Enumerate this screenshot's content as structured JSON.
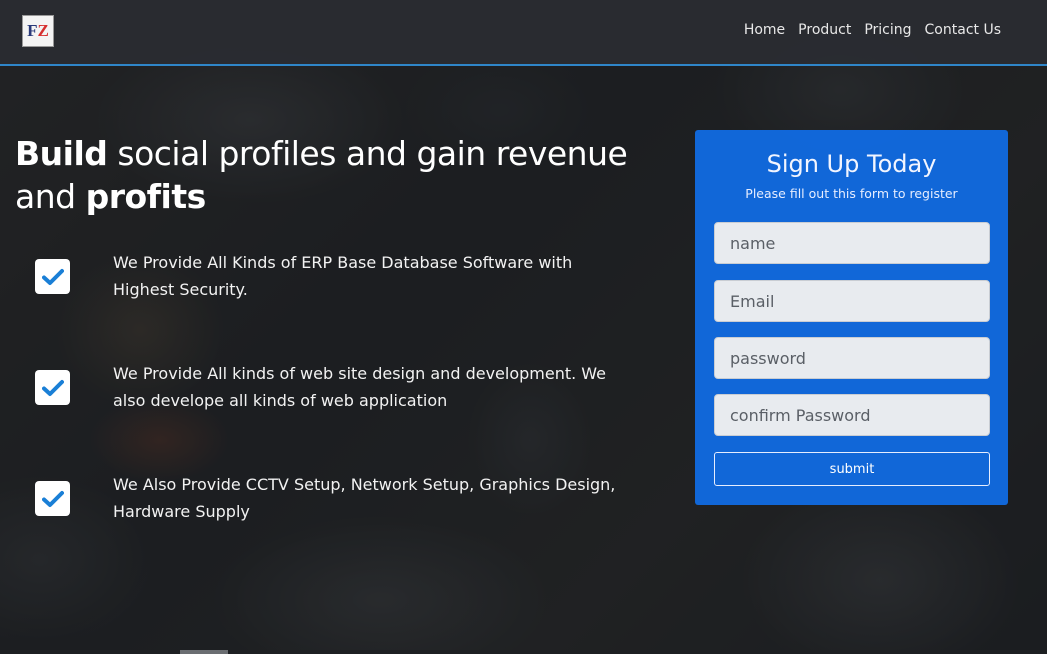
{
  "brand": {
    "logo_text_a": "F",
    "logo_text_b": "Z"
  },
  "nav": {
    "items": [
      "Home",
      "Product",
      "Pricing",
      "Contact Us"
    ]
  },
  "hero": {
    "title_bold_1": "Build",
    "title_mid": " social profiles and gain revenue and ",
    "title_bold_2": "profits"
  },
  "features": [
    {
      "text": "We Provide All Kinds of ERP Base Database Software with Highest Security."
    },
    {
      "text": "We Provide All kinds of web site design and development. We also develope all kinds of web application"
    },
    {
      "text": "We Also Provide CCTV Setup, Network Setup, Graphics Design, Hardware Supply"
    }
  ],
  "signup": {
    "title": "Sign Up Today",
    "subtitle": "Please fill out this form to register",
    "name_placeholder": "name",
    "email_placeholder": "Email",
    "password_placeholder": "password",
    "confirm_placeholder": "confirm Password",
    "submit_label": "submit"
  },
  "colors": {
    "accent": "#2f86c9",
    "card": "#106ee8",
    "check": "#1a7fd6"
  }
}
